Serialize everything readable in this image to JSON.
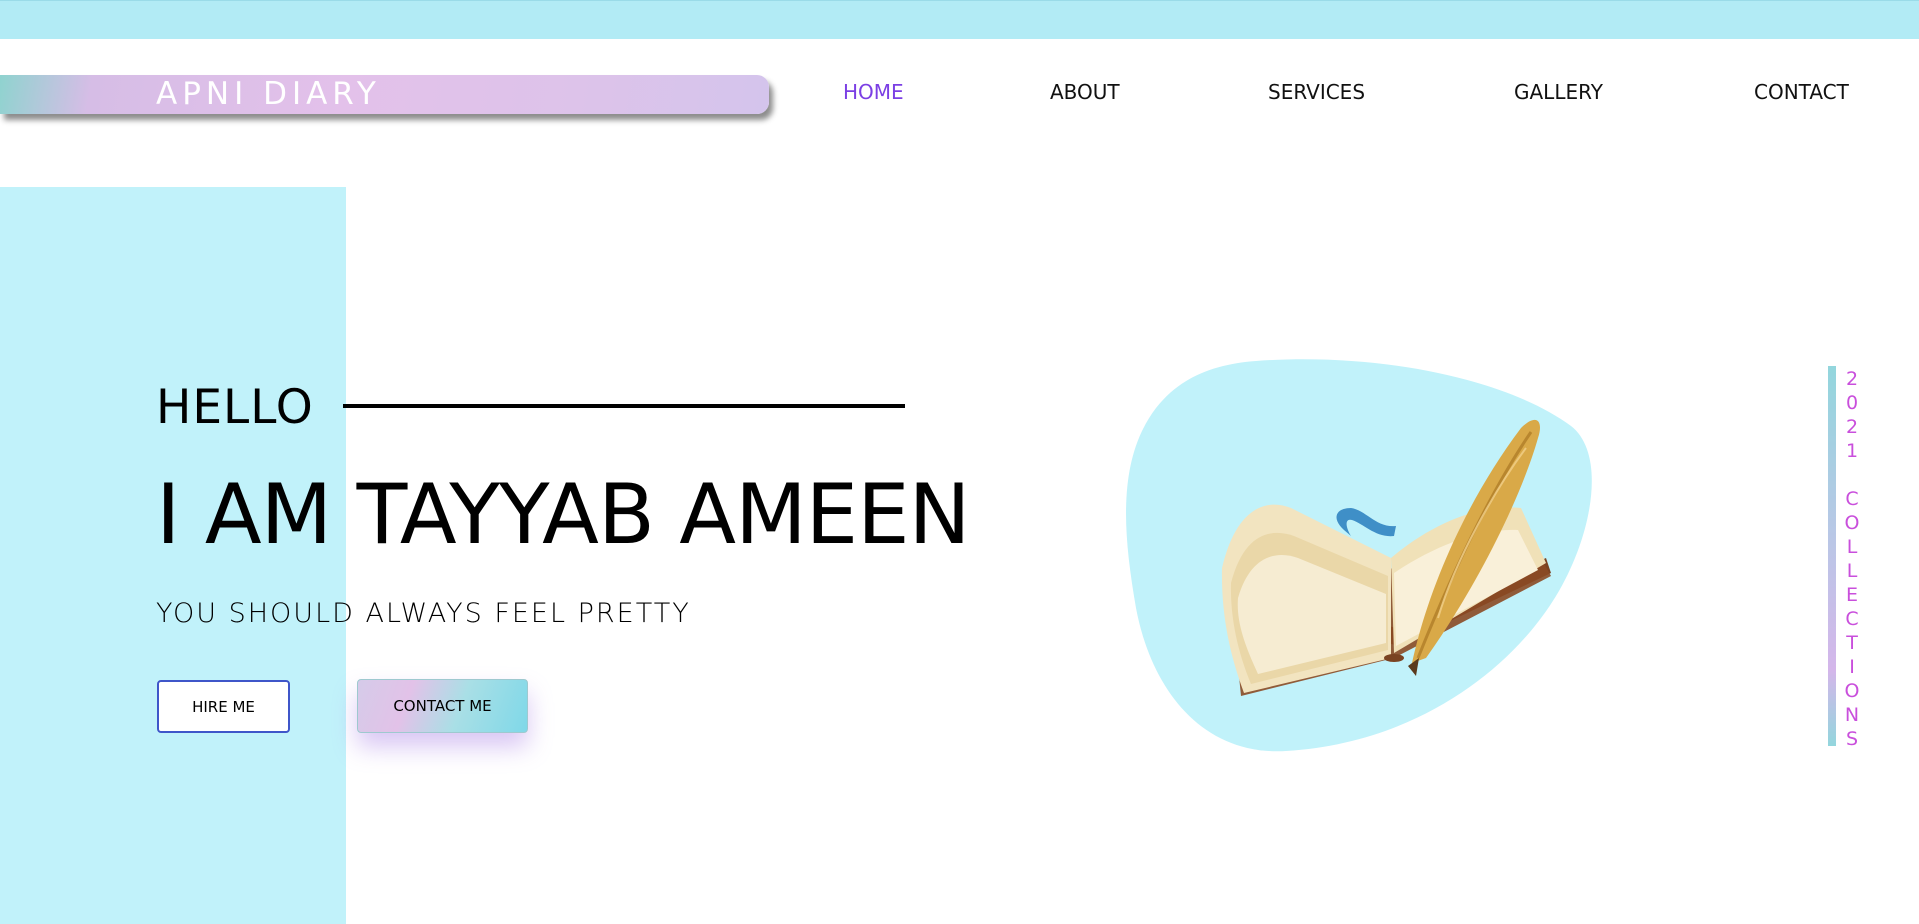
{
  "brand": {
    "logo_text": "APNI DIARY"
  },
  "nav": {
    "items": [
      {
        "label": "HOME",
        "active": true
      },
      {
        "label": "ABOUT",
        "active": false
      },
      {
        "label": "SERVICES",
        "active": false
      },
      {
        "label": "GALLERY",
        "active": false
      },
      {
        "label": "CONTACT",
        "active": false
      }
    ]
  },
  "hero": {
    "greeting": "HELLO",
    "name": "I AM TAYYAB AMEEN",
    "tagline": "YOU SHOULD ALWAYS FEEL PRETTY",
    "hire_label": "HIRE ME",
    "contact_label": "CONTACT ME"
  },
  "side_label": {
    "year": [
      "2",
      "0",
      "2",
      "1"
    ],
    "word": [
      "C",
      "O",
      "L",
      "L",
      "E",
      "C",
      "T",
      "I",
      "O",
      "N",
      "S"
    ]
  },
  "colors": {
    "accent": "#7b3fe4",
    "cyan_panel": "#c1f2fa",
    "top_strip": "#b2ebf5",
    "side_text": "#c94fdc"
  },
  "icons": {
    "hero_image": "book-quill-icon"
  }
}
